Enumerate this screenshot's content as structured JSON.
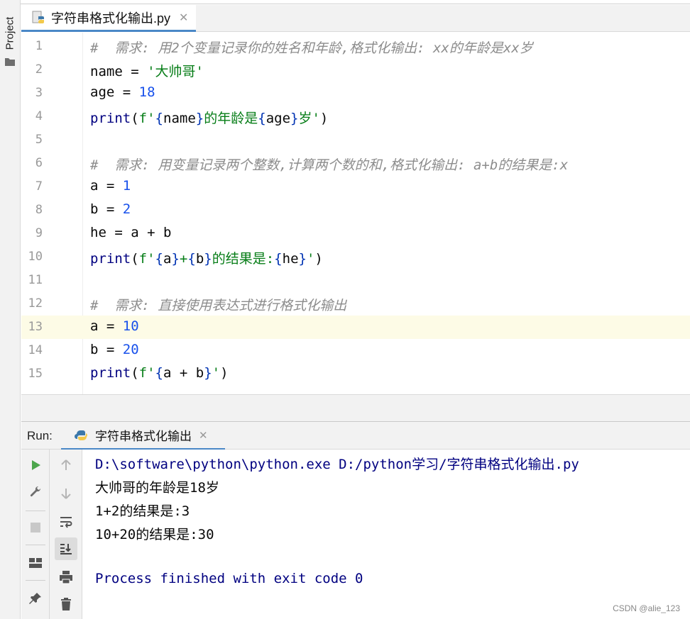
{
  "sidebar": {
    "project_label": "Project"
  },
  "editor_tab": {
    "label": "字符串格式化输出.py"
  },
  "code_lines": [
    {
      "n": "1",
      "segments": [
        {
          "t": "#  需求: 用2个变量记录你的姓名和年龄,格式化输出: xx的年龄是xx岁",
          "c": "comment"
        }
      ]
    },
    {
      "n": "2",
      "segments": [
        {
          "t": "name = ",
          "c": ""
        },
        {
          "t": "'大帅哥'",
          "c": "str"
        }
      ]
    },
    {
      "n": "3",
      "segments": [
        {
          "t": "age = ",
          "c": ""
        },
        {
          "t": "18",
          "c": "num"
        }
      ]
    },
    {
      "n": "4",
      "segments": [
        {
          "t": "print",
          "c": "fn"
        },
        {
          "t": "(",
          "c": ""
        },
        {
          "t": "f'",
          "c": "str"
        },
        {
          "t": "{",
          "c": "brace"
        },
        {
          "t": "name",
          "c": ""
        },
        {
          "t": "}",
          "c": "brace"
        },
        {
          "t": "的年龄是",
          "c": "str"
        },
        {
          "t": "{",
          "c": "brace"
        },
        {
          "t": "age",
          "c": ""
        },
        {
          "t": "}",
          "c": "brace"
        },
        {
          "t": "岁'",
          "c": "str"
        },
        {
          "t": ")",
          "c": ""
        }
      ]
    },
    {
      "n": "5",
      "segments": []
    },
    {
      "n": "6",
      "segments": [
        {
          "t": "#  需求: 用变量记录两个整数,计算两个数的和,格式化输出: a+b的结果是:x",
          "c": "comment"
        }
      ]
    },
    {
      "n": "7",
      "segments": [
        {
          "t": "a = ",
          "c": ""
        },
        {
          "t": "1",
          "c": "num"
        }
      ]
    },
    {
      "n": "8",
      "segments": [
        {
          "t": "b = ",
          "c": ""
        },
        {
          "t": "2",
          "c": "num"
        }
      ]
    },
    {
      "n": "9",
      "segments": [
        {
          "t": "he = a + b",
          "c": ""
        }
      ]
    },
    {
      "n": "10",
      "segments": [
        {
          "t": "print",
          "c": "fn"
        },
        {
          "t": "(",
          "c": ""
        },
        {
          "t": "f'",
          "c": "str"
        },
        {
          "t": "{",
          "c": "brace"
        },
        {
          "t": "a",
          "c": ""
        },
        {
          "t": "}",
          "c": "brace"
        },
        {
          "t": "+",
          "c": "str"
        },
        {
          "t": "{",
          "c": "brace"
        },
        {
          "t": "b",
          "c": ""
        },
        {
          "t": "}",
          "c": "brace"
        },
        {
          "t": "的结果是:",
          "c": "str"
        },
        {
          "t": "{",
          "c": "brace"
        },
        {
          "t": "he",
          "c": ""
        },
        {
          "t": "}",
          "c": "brace"
        },
        {
          "t": "'",
          "c": "str"
        },
        {
          "t": ")",
          "c": ""
        }
      ]
    },
    {
      "n": "11",
      "segments": []
    },
    {
      "n": "12",
      "segments": [
        {
          "t": "#  需求: 直接使用表达式进行格式化输出",
          "c": "comment"
        }
      ]
    },
    {
      "n": "13",
      "current": true,
      "segments": [
        {
          "t": "a = ",
          "c": ""
        },
        {
          "t": "10",
          "c": "num"
        }
      ]
    },
    {
      "n": "14",
      "segments": [
        {
          "t": "b = ",
          "c": ""
        },
        {
          "t": "20",
          "c": "num"
        }
      ]
    },
    {
      "n": "15",
      "segments": [
        {
          "t": "print",
          "c": "fn"
        },
        {
          "t": "(",
          "c": ""
        },
        {
          "t": "f'",
          "c": "str"
        },
        {
          "t": "{",
          "c": "brace"
        },
        {
          "t": "a + b",
          "c": ""
        },
        {
          "t": "}",
          "c": "brace"
        },
        {
          "t": "'",
          "c": "str"
        },
        {
          "t": ")",
          "c": ""
        }
      ]
    }
  ],
  "run_panel": {
    "title": "Run:",
    "tab_label": "字符串格式化输出"
  },
  "console": {
    "lines": [
      {
        "t": "D:\\software\\python\\python.exe D:/python学习/字符串格式化输出.py",
        "c": "out-cmd"
      },
      {
        "t": "大帅哥的年龄是18岁",
        "c": "out-text"
      },
      {
        "t": "1+2的结果是:3",
        "c": "out-text"
      },
      {
        "t": "10+20的结果是:30",
        "c": "out-text"
      },
      {
        "t": "",
        "c": "out-text"
      },
      {
        "t": "Process finished with exit code 0",
        "c": "out-proc"
      }
    ]
  },
  "watermark": "CSDN @alie_123",
  "colors": {
    "accent": "#4a88c7",
    "string": "#067d17",
    "number": "#1750eb",
    "keyword_fn": "#000080",
    "comment": "#8c8c8c"
  }
}
